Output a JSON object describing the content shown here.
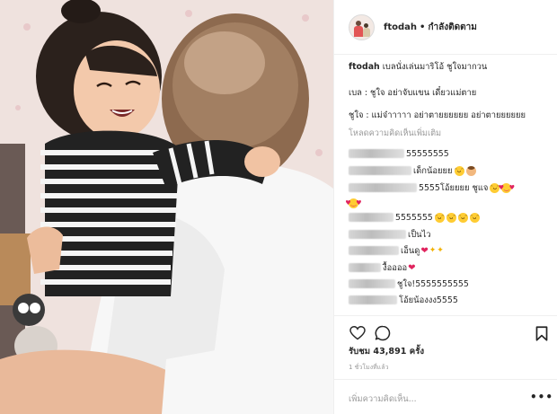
{
  "header": {
    "username": "ftodah",
    "separator": "•",
    "follow_label": "กำลังติดตาม"
  },
  "caption": {
    "username": "ftodah",
    "line1": "เบลนั่งเล่นมาริโอ้ ชูใจมากวน",
    "line2": "เบล : ชูใจ อย่าจับแขน เดี๋ยวแม่ตาย",
    "line3": "ชูใจ : แม่จ๋าาาาา อย่าตายยยยยย อย่าตายยยยยย",
    "load_more": "โหลดความคิดเห็นเพิ่มเติม"
  },
  "comments": [
    {
      "text": "55555555",
      "emojis": []
    },
    {
      "text": "เด็กน้อยยย",
      "emojis": [
        "happy",
        "woman"
      ]
    },
    {
      "text": "5555โอ้ยยยย ชูแจ",
      "emojis": [
        "happy",
        "heart-eyes"
      ]
    },
    {
      "text": "",
      "emojis": [
        "heart-eyes"
      ]
    },
    {
      "text": "5555555",
      "emojis": [
        "happy",
        "happy",
        "happy",
        "happy"
      ]
    },
    {
      "text": "เป็นไว",
      "emojis": []
    },
    {
      "text": "เอ็นดู",
      "emojis": [
        "heart",
        "sparkle",
        "sparkle"
      ]
    },
    {
      "text": "งื้ออออ",
      "emojis": [
        "heart"
      ]
    },
    {
      "text": "ชูใจ!5555555555",
      "emojis": []
    },
    {
      "text": "โอ้ยน้องงง5555",
      "emojis": []
    }
  ],
  "actions": {
    "like_icon": "heart-outline-icon",
    "comment_icon": "comment-bubble-icon",
    "save_icon": "bookmark-icon",
    "likes_text": "รับชม 43,891 ครั้ง",
    "time_text": "1 ชั่วโมงที่แล้ว",
    "comment_placeholder": "เพิ่มความคิดเห็น...",
    "more_icon": "more-options-icon"
  }
}
